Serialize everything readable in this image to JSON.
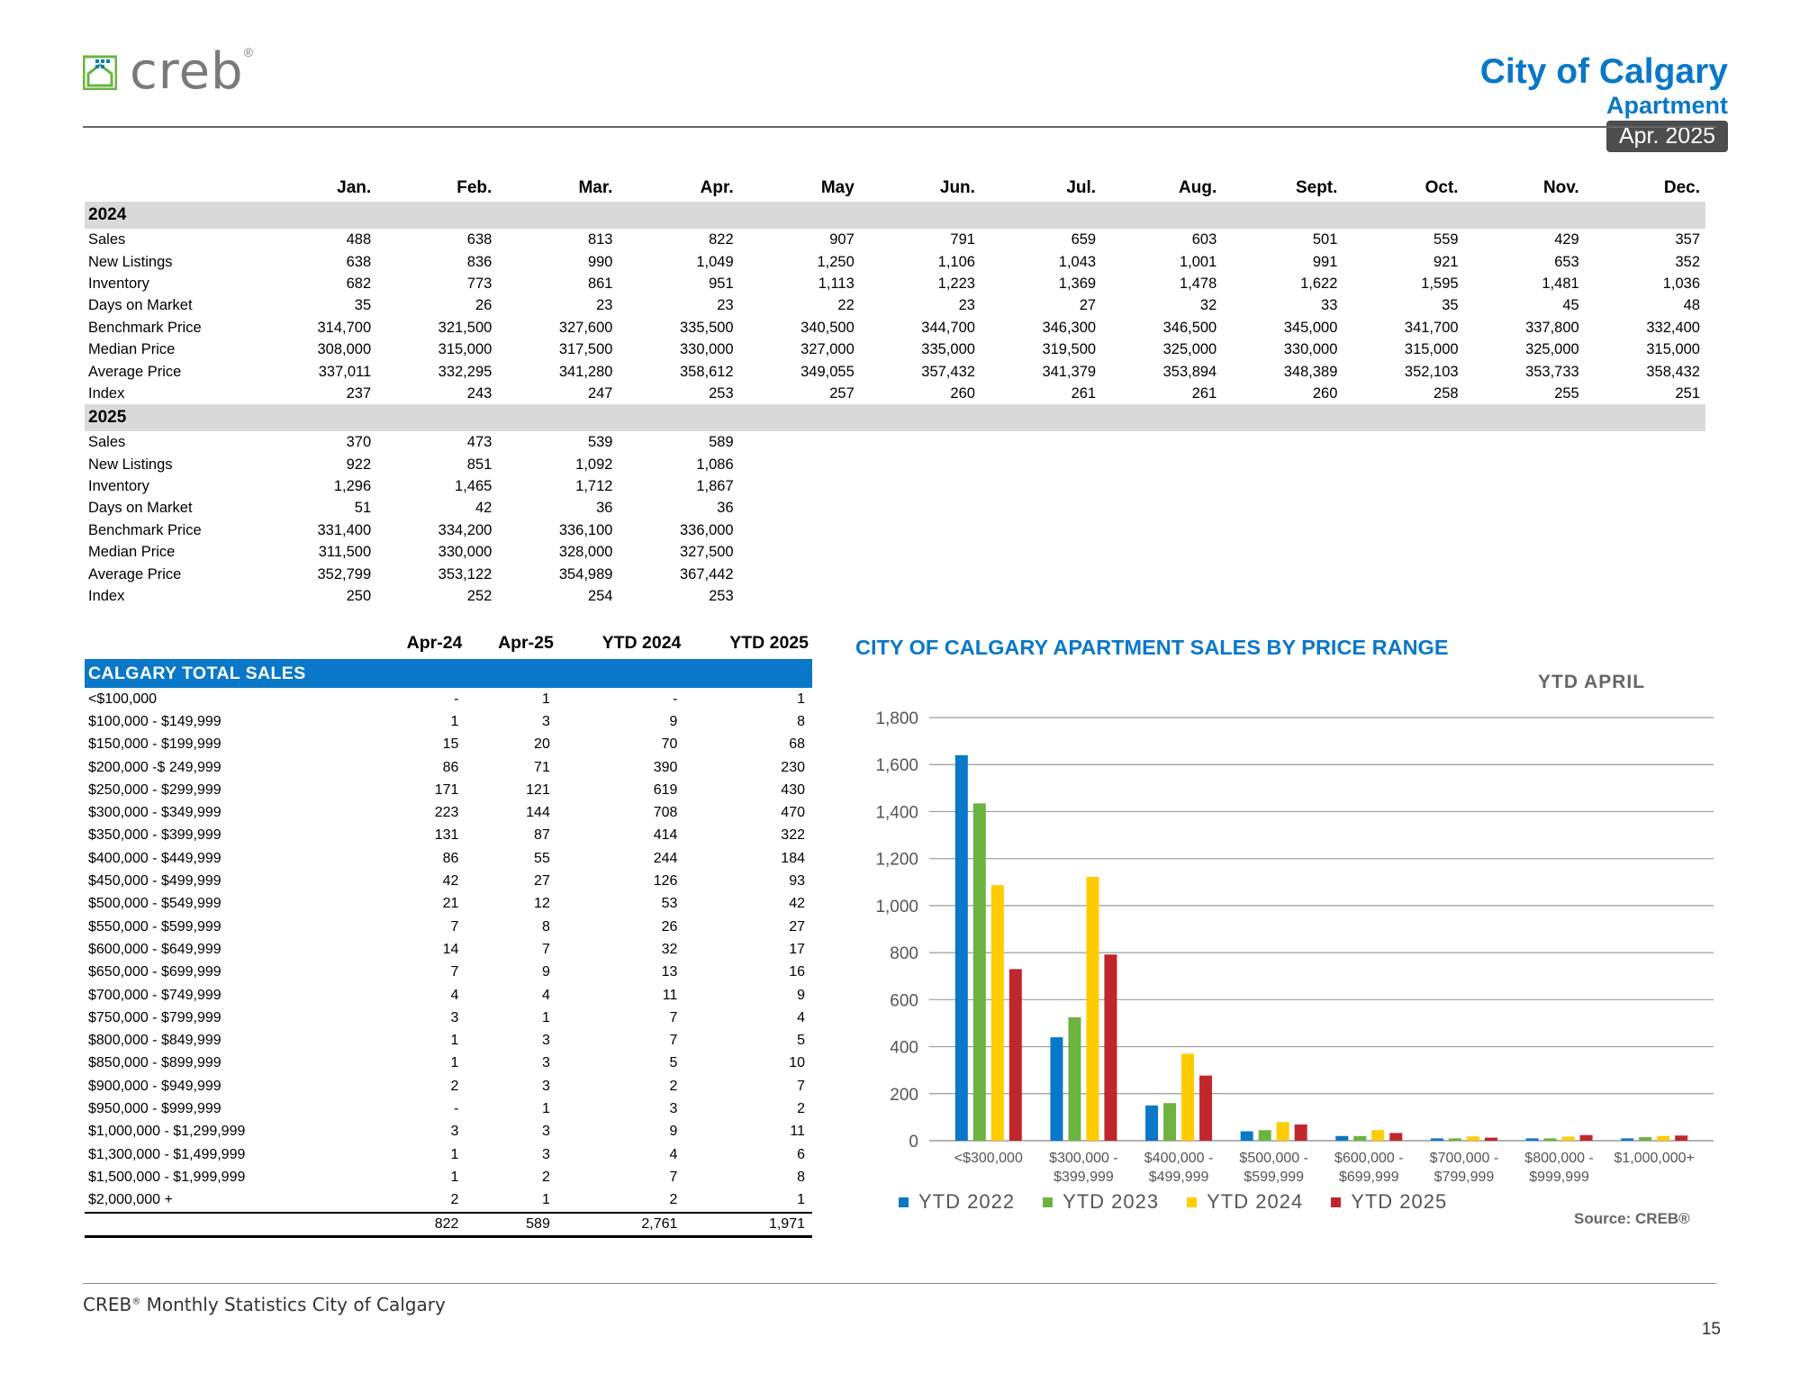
{
  "header": {
    "logo_text": "creb",
    "logo_reg": "®",
    "city": "City of Calgary",
    "property_type": "Apartment",
    "period": "Apr. 2025"
  },
  "monthly": {
    "months": [
      "Jan.",
      "Feb.",
      "Mar.",
      "Apr.",
      "May",
      "Jun.",
      "Jul.",
      "Aug.",
      "Sept.",
      "Oct.",
      "Nov.",
      "Dec."
    ],
    "years": [
      {
        "year": "2024",
        "rows": [
          {
            "label": "Sales",
            "values": [
              "488",
              "638",
              "813",
              "822",
              "907",
              "791",
              "659",
              "603",
              "501",
              "559",
              "429",
              "357"
            ]
          },
          {
            "label": "New Listings",
            "values": [
              "638",
              "836",
              "990",
              "1,049",
              "1,250",
              "1,106",
              "1,043",
              "1,001",
              "991",
              "921",
              "653",
              "352"
            ]
          },
          {
            "label": "Inventory",
            "values": [
              "682",
              "773",
              "861",
              "951",
              "1,113",
              "1,223",
              "1,369",
              "1,478",
              "1,622",
              "1,595",
              "1,481",
              "1,036"
            ]
          },
          {
            "label": "Days on Market",
            "values": [
              "35",
              "26",
              "23",
              "23",
              "22",
              "23",
              "27",
              "32",
              "33",
              "35",
              "45",
              "48"
            ]
          },
          {
            "label": "Benchmark Price",
            "values": [
              "314,700",
              "321,500",
              "327,600",
              "335,500",
              "340,500",
              "344,700",
              "346,300",
              "346,500",
              "345,000",
              "341,700",
              "337,800",
              "332,400"
            ]
          },
          {
            "label": "Median Price",
            "values": [
              "308,000",
              "315,000",
              "317,500",
              "330,000",
              "327,000",
              "335,000",
              "319,500",
              "325,000",
              "330,000",
              "315,000",
              "325,000",
              "315,000"
            ]
          },
          {
            "label": "Average Price",
            "values": [
              "337,011",
              "332,295",
              "341,280",
              "358,612",
              "349,055",
              "357,432",
              "341,379",
              "353,894",
              "348,389",
              "352,103",
              "353,733",
              "358,432"
            ]
          },
          {
            "label": "Index",
            "values": [
              "237",
              "243",
              "247",
              "253",
              "257",
              "260",
              "261",
              "261",
              "260",
              "258",
              "255",
              "251"
            ]
          }
        ]
      },
      {
        "year": "2025",
        "rows": [
          {
            "label": "Sales",
            "values": [
              "370",
              "473",
              "539",
              "589",
              "",
              "",
              "",
              "",
              "",
              "",
              "",
              ""
            ]
          },
          {
            "label": "New Listings",
            "values": [
              "922",
              "851",
              "1,092",
              "1,086",
              "",
              "",
              "",
              "",
              "",
              "",
              "",
              ""
            ]
          },
          {
            "label": "Inventory",
            "values": [
              "1,296",
              "1,465",
              "1,712",
              "1,867",
              "",
              "",
              "",
              "",
              "",
              "",
              "",
              ""
            ]
          },
          {
            "label": "Days on Market",
            "values": [
              "51",
              "42",
              "36",
              "36",
              "",
              "",
              "",
              "",
              "",
              "",
              "",
              ""
            ]
          },
          {
            "label": "Benchmark Price",
            "values": [
              "331,400",
              "334,200",
              "336,100",
              "336,000",
              "",
              "",
              "",
              "",
              "",
              "",
              "",
              ""
            ]
          },
          {
            "label": "Median Price",
            "values": [
              "311,500",
              "330,000",
              "328,000",
              "327,500",
              "",
              "",
              "",
              "",
              "",
              "",
              "",
              ""
            ]
          },
          {
            "label": "Average Price",
            "values": [
              "352,799",
              "353,122",
              "354,989",
              "367,442",
              "",
              "",
              "",
              "",
              "",
              "",
              "",
              ""
            ]
          },
          {
            "label": "Index",
            "values": [
              "250",
              "252",
              "254",
              "253",
              "",
              "",
              "",
              "",
              "",
              "",
              "",
              ""
            ]
          }
        ]
      }
    ]
  },
  "price_table": {
    "columns": [
      "Apr-24",
      "Apr-25",
      "YTD 2024",
      "YTD 2025"
    ],
    "band_label": "CALGARY TOTAL SALES",
    "rows": [
      {
        "label": "<$100,000",
        "values": [
          "-",
          "1",
          "-",
          "1"
        ]
      },
      {
        "label": "$100,000 - $149,999",
        "values": [
          "1",
          "3",
          "9",
          "8"
        ]
      },
      {
        "label": "$150,000 - $199,999",
        "values": [
          "15",
          "20",
          "70",
          "68"
        ]
      },
      {
        "label": "$200,000 -$ 249,999",
        "values": [
          "86",
          "71",
          "390",
          "230"
        ]
      },
      {
        "label": "$250,000 - $299,999",
        "values": [
          "171",
          "121",
          "619",
          "430"
        ]
      },
      {
        "label": "$300,000 - $349,999",
        "values": [
          "223",
          "144",
          "708",
          "470"
        ]
      },
      {
        "label": "$350,000 - $399,999",
        "values": [
          "131",
          "87",
          "414",
          "322"
        ]
      },
      {
        "label": "$400,000 - $449,999",
        "values": [
          "86",
          "55",
          "244",
          "184"
        ]
      },
      {
        "label": "$450,000 - $499,999",
        "values": [
          "42",
          "27",
          "126",
          "93"
        ]
      },
      {
        "label": "$500,000 - $549,999",
        "values": [
          "21",
          "12",
          "53",
          "42"
        ]
      },
      {
        "label": "$550,000 - $599,999",
        "values": [
          "7",
          "8",
          "26",
          "27"
        ]
      },
      {
        "label": "$600,000 - $649,999",
        "values": [
          "14",
          "7",
          "32",
          "17"
        ]
      },
      {
        "label": "$650,000 - $699,999",
        "values": [
          "7",
          "9",
          "13",
          "16"
        ]
      },
      {
        "label": "$700,000 - $749,999",
        "values": [
          "4",
          "4",
          "11",
          "9"
        ]
      },
      {
        "label": "$750,000 - $799,999",
        "values": [
          "3",
          "1",
          "7",
          "4"
        ]
      },
      {
        "label": "$800,000 - $849,999",
        "values": [
          "1",
          "3",
          "7",
          "5"
        ]
      },
      {
        "label": "$850,000 - $899,999",
        "values": [
          "1",
          "3",
          "5",
          "10"
        ]
      },
      {
        "label": "$900,000 - $949,999",
        "values": [
          "2",
          "3",
          "2",
          "7"
        ]
      },
      {
        "label": "$950,000 - $999,999",
        "values": [
          "-",
          "1",
          "3",
          "2"
        ]
      },
      {
        "label": "$1,000,000 - $1,299,999",
        "values": [
          "3",
          "3",
          "9",
          "11"
        ]
      },
      {
        "label": "$1,300,000 - $1,499,999",
        "values": [
          "1",
          "3",
          "4",
          "6"
        ]
      },
      {
        "label": "$1,500,000 - $1,999,999",
        "values": [
          "1",
          "2",
          "7",
          "8"
        ]
      },
      {
        "label": "$2,000,000 +",
        "values": [
          "2",
          "1",
          "2",
          "1"
        ]
      }
    ],
    "totals": [
      "822",
      "589",
      "2,761",
      "1,971"
    ]
  },
  "chart_data": {
    "type": "bar",
    "title": "CITY OF CALGARY APARTMENT SALES BY PRICE RANGE",
    "subtitle": "YTD  APRIL",
    "categories": [
      "<$300,000",
      "$300,000 - $399,999",
      "$400,000 - $499,999",
      "$500,000 - $599,999",
      "$600,000 - $699,999",
      "$700,000 - $799,999",
      "$800,000 - $999,999",
      "$1,000,000+"
    ],
    "category_lines": [
      [
        "<$300,000"
      ],
      [
        "$300,000 -",
        "$399,999"
      ],
      [
        "$400,000 -",
        "$499,999"
      ],
      [
        "$500,000 -",
        "$599,999"
      ],
      [
        "$600,000 -",
        "$699,999"
      ],
      [
        "$700,000 -",
        "$799,999"
      ],
      [
        "$800,000 -",
        "$999,999"
      ],
      [
        "$1,000,000+"
      ]
    ],
    "series": [
      {
        "name": "YTD  2022",
        "color": "#0a78c8",
        "values": [
          1640,
          440,
          150,
          40,
          20,
          10,
          10,
          10
        ]
      },
      {
        "name": "YTD  2023",
        "color": "#6db33f",
        "values": [
          1435,
          525,
          160,
          45,
          20,
          10,
          10,
          15
        ]
      },
      {
        "name": "YTD  2024",
        "color": "#ffcc00",
        "values": [
          1087,
          1122,
          370,
          79,
          45,
          18,
          17,
          20
        ]
      },
      {
        "name": "YTD  2025",
        "color": "#c0272d",
        "values": [
          730,
          792,
          277,
          69,
          33,
          13,
          24,
          22
        ]
      }
    ],
    "yticks": [
      "0",
      "200",
      "400",
      "600",
      "800",
      "1,000",
      "1,200",
      "1,400",
      "1,600",
      "1,800"
    ],
    "ylim": [
      0,
      1800
    ],
    "grid": true,
    "legend_position": "bottom-left",
    "source": "Source: CREB®"
  },
  "footer": {
    "text_pre": "CREB",
    "text_sup": "®",
    "text_post": " Monthly Statistics City of Calgary",
    "page_number": "15"
  }
}
